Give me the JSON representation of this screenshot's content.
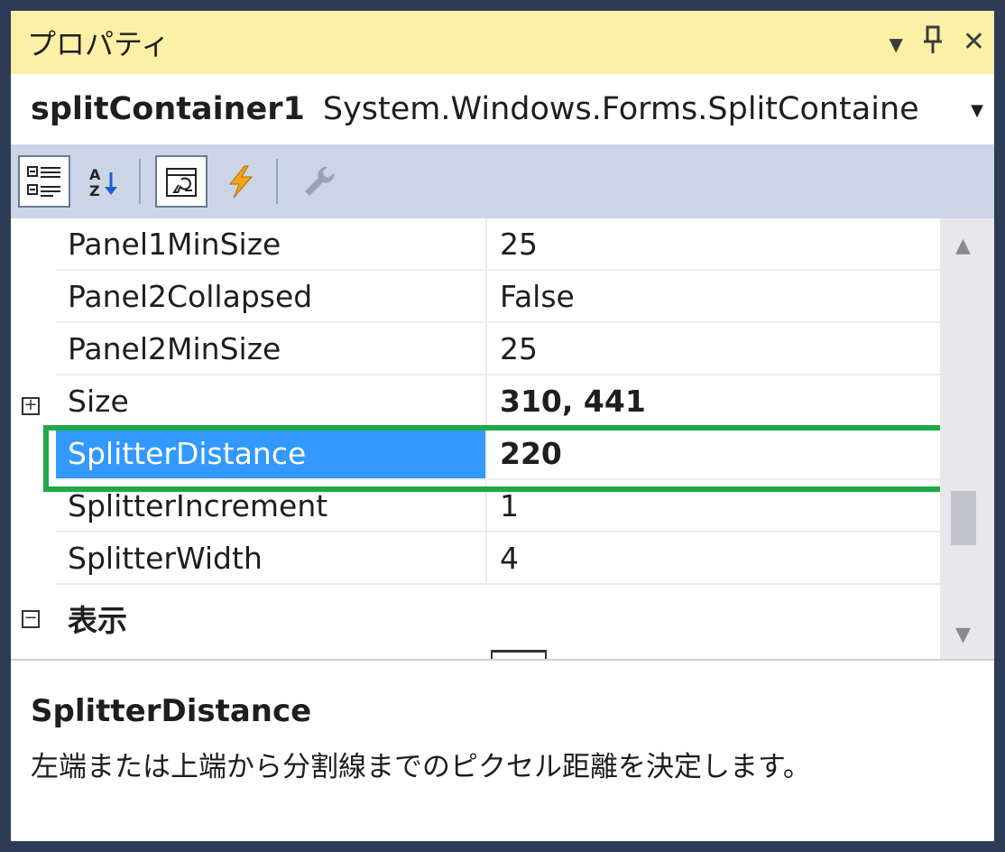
{
  "window": {
    "title": "プロパティ",
    "controls": {
      "dropdown_icon": "chevron-down-icon",
      "pin_icon": "pin-icon",
      "close_icon": "close-icon"
    }
  },
  "object_selector": {
    "name": "splitContainer1",
    "type": "System.Windows.Forms.SplitContaine"
  },
  "toolbar": {
    "buttons": [
      {
        "icon": "categorized-icon",
        "active": true
      },
      {
        "icon": "alphabetical-icon",
        "active": false
      },
      {
        "icon": "properties-page-icon",
        "active": true
      },
      {
        "icon": "events-lightning-icon",
        "active": false
      },
      {
        "icon": "wrench-icon",
        "active": false,
        "disabled": true
      }
    ]
  },
  "properties": [
    {
      "name": "Panel1MinSize",
      "value": "25"
    },
    {
      "name": "Panel2Collapsed",
      "value": "False"
    },
    {
      "name": "Panel2MinSize",
      "value": "25"
    },
    {
      "name": "Size",
      "value": "310, 441",
      "expander": "+"
    },
    {
      "name": "SplitterDistance",
      "value": "220",
      "selected": true
    },
    {
      "name": "SplitterIncrement",
      "value": "1"
    },
    {
      "name": "SplitterWidth",
      "value": "4"
    }
  ],
  "category": {
    "label": "表示",
    "expander": "−"
  },
  "description": {
    "title": "SplitterDistance",
    "text": "左端または上端から分割線までのピクセル距離を決定します。"
  },
  "colors": {
    "title_bar": "#fbf0a5",
    "toolbar": "#ccd5e6",
    "selection": "#3399ff",
    "highlight_box": "#1fa74a",
    "frame": "#2d3b57"
  }
}
